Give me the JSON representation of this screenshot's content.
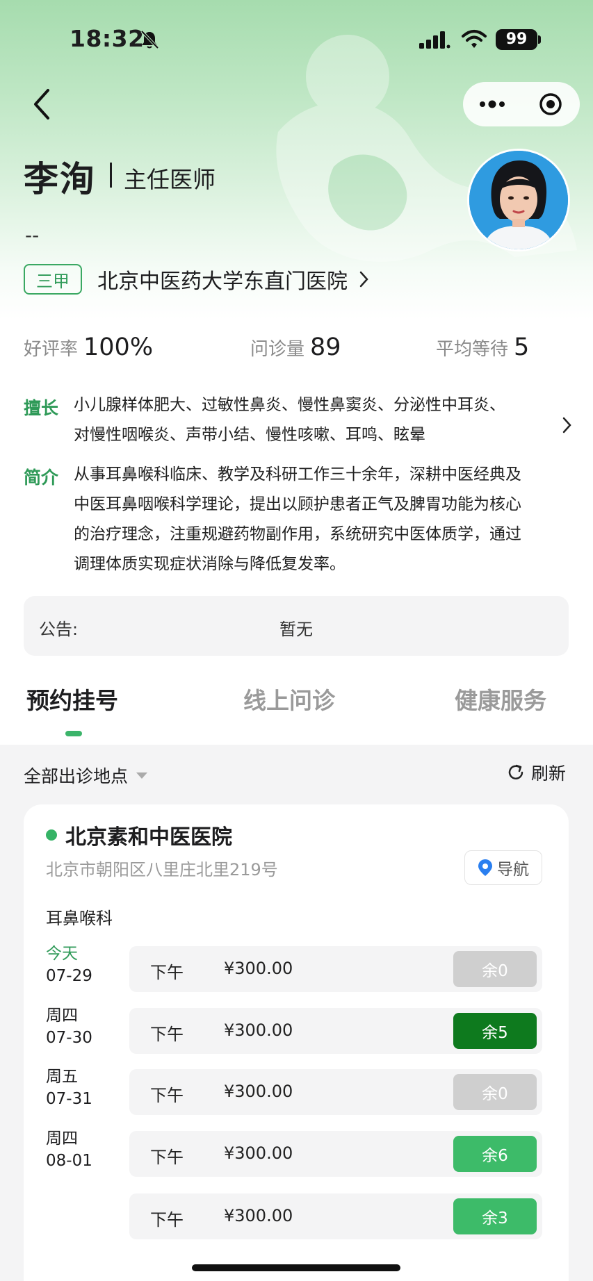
{
  "status_bar": {
    "time": "18:32",
    "battery": "99"
  },
  "doctor": {
    "name": "李洵",
    "title": "主任医师",
    "department": "--",
    "hospital_grade": "三甲",
    "hospital_name": "北京中医药大学东直门医院"
  },
  "stats": {
    "rating_label": "好评率",
    "rating_value": "100%",
    "consults_label": "问诊量",
    "consults_value": "89",
    "wait_label": "平均等待",
    "wait_value": "5"
  },
  "specialty": {
    "label": "擅长",
    "lines": [
      "小儿腺样体肥大、过敏性鼻炎、慢性鼻窦炎、分泌性中耳炎、",
      "对慢性咽喉炎、声带小结、慢性咳嗽、耳鸣、眩晕"
    ]
  },
  "intro": {
    "label": "简介",
    "lines": [
      "从事耳鼻喉科临床、教学及科研工作三十余年，深耕中医经典及",
      "中医耳鼻咽喉科学理论，提出以顾护患者正气及脾胃功能为核心",
      "的治疗理念，注重规避药物副作用，系统研究中医体质学，通过",
      "调理体质实现症状消除与降低复发率。"
    ]
  },
  "notice": {
    "label": "公告:",
    "value": "暂无"
  },
  "tabs": [
    "预约挂号",
    "线上问诊",
    "健康服务"
  ],
  "filter": {
    "label": "全部出诊地点",
    "refresh_label": "刷新"
  },
  "location": {
    "name": "北京素和中医医院",
    "address": "北京市朝阳区八里庄北里219号",
    "nav_label": "导航",
    "department": "耳鼻喉科"
  },
  "colors": {
    "accent_green": "#36b366",
    "slot_available_dark": "#0e7a1e",
    "slot_available": "#3dbb69",
    "slot_empty": "#cfcfcf"
  },
  "schedule": [
    {
      "weekday": "今天",
      "date": "07-29",
      "period": "下午",
      "price": "¥300.00",
      "remaining": "余0",
      "state": "empty",
      "is_today": true
    },
    {
      "weekday": "周四",
      "date": "07-30",
      "period": "下午",
      "price": "¥300.00",
      "remaining": "余5",
      "state": "selected",
      "is_today": false
    },
    {
      "weekday": "周五",
      "date": "07-31",
      "period": "下午",
      "price": "¥300.00",
      "remaining": "余0",
      "state": "empty",
      "is_today": false
    },
    {
      "weekday": "周四",
      "date": "08-01",
      "period": "下午",
      "price": "¥300.00",
      "remaining": "余6",
      "state": "available",
      "is_today": false
    },
    {
      "weekday": "",
      "date": "",
      "period": "下午",
      "price": "¥300.00",
      "remaining": "余3",
      "state": "available",
      "is_today": false
    }
  ]
}
